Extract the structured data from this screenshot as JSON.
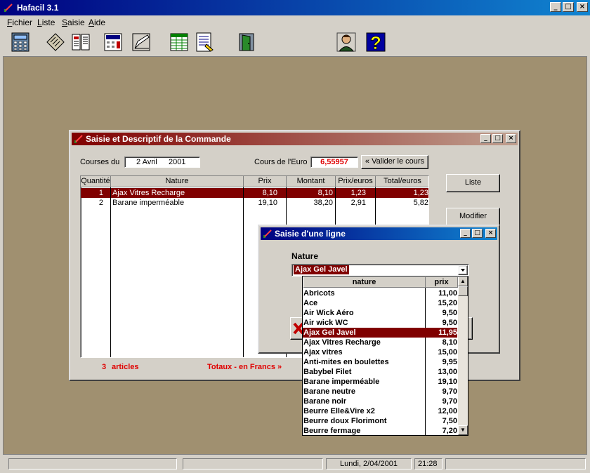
{
  "app": {
    "title": "Hafacil  3.1"
  },
  "menu": [
    "Fichier",
    "Liste",
    "Saisie",
    "Aide"
  ],
  "toolbar": [
    "calculator-icon",
    "ledger-icon",
    "book-icon",
    "cash-register-icon",
    "edit-form-icon",
    "spreadsheet-icon",
    "report-icon",
    "door-exit-icon",
    "person-icon",
    "help-icon"
  ],
  "commande": {
    "title": "Saisie et Descriptif de la Commande",
    "courses_label": "Courses du",
    "date_day": "2 Avril",
    "date_year": "2001",
    "cours_label": "Cours de l'Euro",
    "cours_value": "6,55957",
    "valider_button": "« Valider le cours",
    "liste_button": "Liste",
    "modifier_button": "Modifier",
    "columns": [
      "Quantité",
      "Nature",
      "Prix",
      "Montant",
      "Prix/euros",
      "Total/euros"
    ],
    "rows": [
      {
        "qty": "1",
        "nature": "Ajax Vitres Recharge",
        "prix": "8,10",
        "montant": "8,10",
        "prix_euros": "1,23",
        "total_euros": "1,23"
      },
      {
        "qty": "2",
        "nature": "Barane imperméable",
        "prix": "19,10",
        "montant": "38,20",
        "prix_euros": "2,91",
        "total_euros": "5,82"
      }
    ],
    "articles_count": "3",
    "articles_label": "articles",
    "totaux_label": "Totaux - en Francs »"
  },
  "saisie": {
    "title": "Saisie d'une ligne",
    "nature_label": "Nature",
    "selected": "Ajax Gel Javel"
  },
  "dropdown": {
    "columns": [
      "nature",
      "prix"
    ],
    "items": [
      {
        "nature": "Abricots",
        "prix": "11,00"
      },
      {
        "nature": "Ace",
        "prix": "15,20"
      },
      {
        "nature": "Air Wick Aéro",
        "prix": "9,50"
      },
      {
        "nature": "Air wick WC",
        "prix": "9,50"
      },
      {
        "nature": "Ajax Gel Javel",
        "prix": "11,95"
      },
      {
        "nature": "Ajax Vitres Recharge",
        "prix": "8,10"
      },
      {
        "nature": "Ajax vitres",
        "prix": "15,00"
      },
      {
        "nature": "Anti-mites en boulettes",
        "prix": "9,95"
      },
      {
        "nature": "Babybel Filet",
        "prix": "13,00"
      },
      {
        "nature": "Barane imperméable",
        "prix": "19,10"
      },
      {
        "nature": "Barane neutre",
        "prix": "9,70"
      },
      {
        "nature": "Barane noir",
        "prix": "9,70"
      },
      {
        "nature": "Beurre Elle&Vire x2",
        "prix": "12,00"
      },
      {
        "nature": "Beurre doux Florimont",
        "prix": "7,50"
      },
      {
        "nature": "Beurre fermage",
        "prix": "7,20"
      }
    ],
    "selected_index": 4
  },
  "status": {
    "date": "Lundi,  2/04/2001",
    "time": "21:28"
  }
}
